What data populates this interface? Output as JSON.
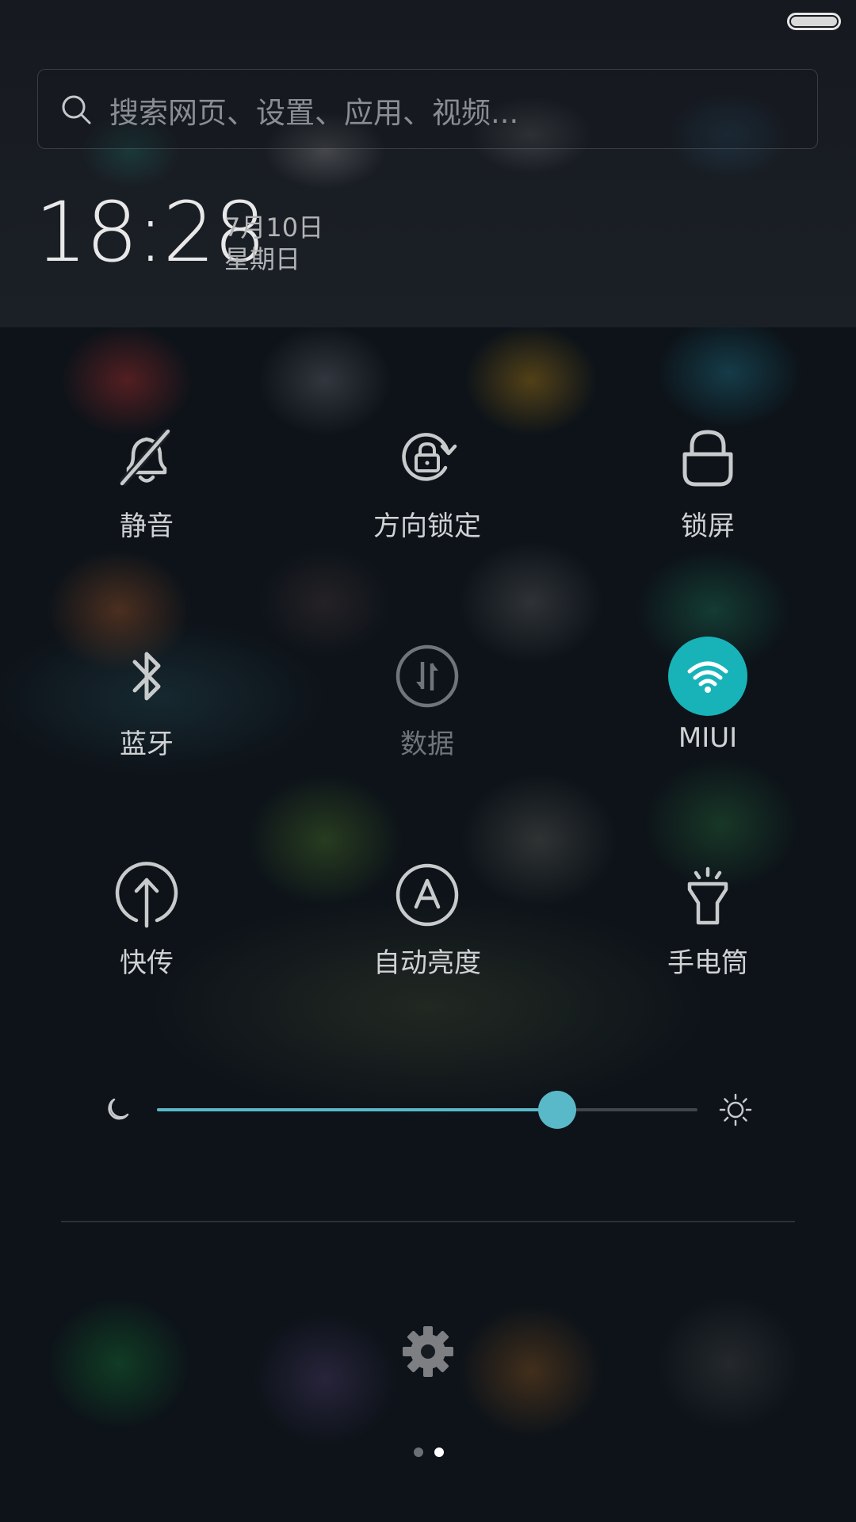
{
  "status_bar": {
    "battery_level": 1.0
  },
  "search": {
    "placeholder": "搜索网页、设置、应用、视频..."
  },
  "clock": {
    "time": "18:28",
    "date": "7月10日",
    "weekday": "星期日"
  },
  "toggles": [
    {
      "label": "静音",
      "icon": "bell-off-icon",
      "active": false
    },
    {
      "label": "方向锁定",
      "icon": "rotation-lock-icon",
      "active": false
    },
    {
      "label": "锁屏",
      "icon": "lock-icon",
      "active": false
    },
    {
      "label": "蓝牙",
      "icon": "bluetooth-icon",
      "active": false
    },
    {
      "label": "数据",
      "icon": "mobile-data-icon",
      "active": false,
      "dimmed": true
    },
    {
      "label": "MIUI",
      "icon": "wifi-icon",
      "active": true
    },
    {
      "label": "快传",
      "icon": "transfer-icon",
      "active": false
    },
    {
      "label": "自动亮度",
      "icon": "auto-brightness-icon",
      "active": false
    },
    {
      "label": "手电筒",
      "icon": "flashlight-icon",
      "active": false
    }
  ],
  "brightness": {
    "level": 0.74,
    "min_icon": "moon-icon",
    "max_icon": "sun-icon"
  },
  "settings": {
    "icon": "gear-icon"
  },
  "pager": {
    "pages": 2,
    "current": 2
  },
  "colors": {
    "accent": "#5ab9c8",
    "wifi_active_bg": "#17b3b8",
    "icon_normal": "#c8cacc",
    "icon_dimmed": "#6f7579"
  }
}
